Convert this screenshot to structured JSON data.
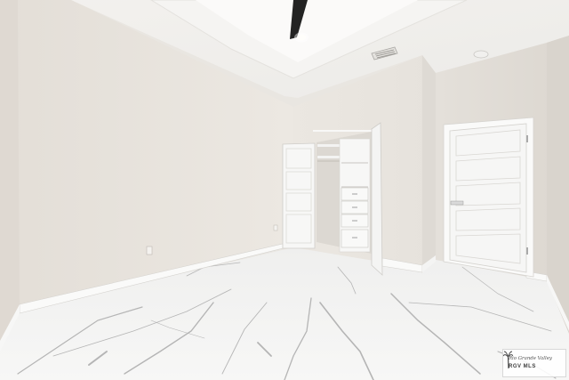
{
  "photo": {
    "subject": "empty-bedroom-interior"
  },
  "watermark": {
    "script_text": "Rio Grande Valley",
    "brand_text": "RGV MLS",
    "logo_icon": "palm-tree-icon"
  },
  "colors": {
    "wall": "#e6e1da",
    "ceiling": "#f1efec",
    "door": "#f7f7f6",
    "trim": "#fbfbfa",
    "floor": "#f2f2f1",
    "vein": "#b8b8b8",
    "fan": "#2a2a2a"
  }
}
